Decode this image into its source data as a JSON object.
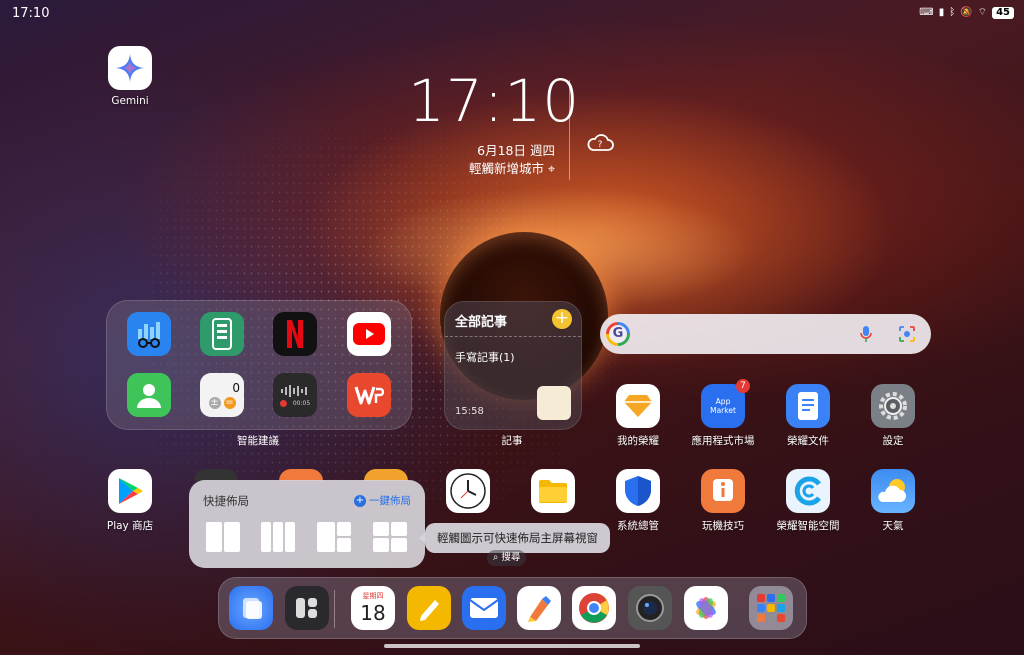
{
  "status_bar": {
    "time": "17:10",
    "battery": "45"
  },
  "clock": {
    "time": "17:10",
    "date": "6月18日 週四",
    "location": "輕觸新增城市"
  },
  "gemini": {
    "label": "Gemini"
  },
  "suggestions_folder": {
    "label": "智能建議",
    "calculator_display": "0",
    "recorder_time": "00:05"
  },
  "notes_widget": {
    "title": "全部記事",
    "item": "手寫記事(1)",
    "time": "15:58",
    "label": "記事"
  },
  "search_bar": {
    "logo": "G"
  },
  "apps_row1": [
    {
      "label": "我的榮耀"
    },
    {
      "label": "應用程式市場",
      "badge": "7",
      "icon_text": "App Market"
    },
    {
      "label": "榮耀文件"
    },
    {
      "label": "設定"
    }
  ],
  "apps_row2": [
    {
      "label": "Play 商店"
    },
    {
      "label": "系統總管"
    },
    {
      "label": "玩機技巧"
    },
    {
      "label": "榮耀智能空間"
    },
    {
      "label": "天氣"
    }
  ],
  "quick_layout": {
    "title": "快捷佈局",
    "one_tap": "一鍵佈局"
  },
  "tooltip": {
    "text": "輕觸圖示可快速佈局主屏幕視窗"
  },
  "search_pill": {
    "label": "搜尋"
  },
  "dock": {
    "calendar_weekday": "星期四",
    "calendar_day": "18"
  }
}
